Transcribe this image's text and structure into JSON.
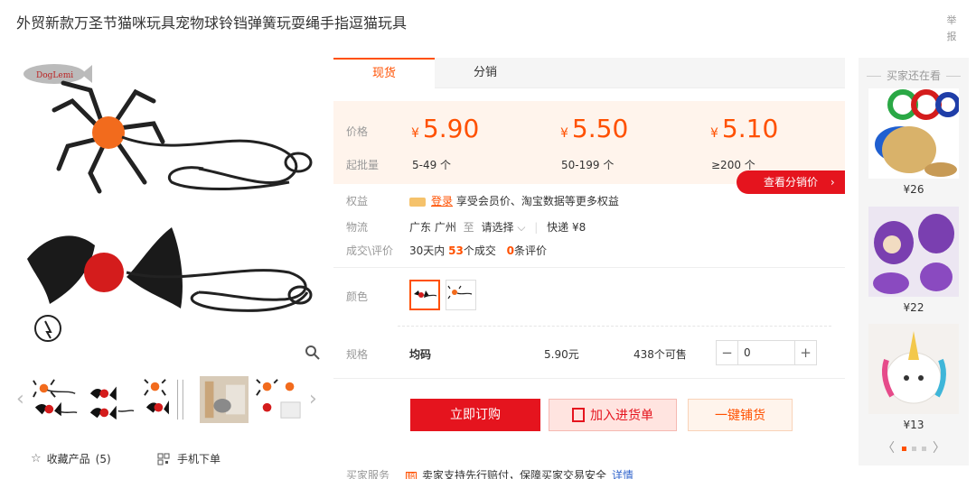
{
  "product": {
    "title": "外贸新款万圣节猫咪玩具宠物球铃铛弹簧玩耍绳手指逗猫玩具",
    "report_label": "举报",
    "brand_logo_text": "DogLemi"
  },
  "gallery": {
    "thumbs_count": 5,
    "favorite_label": "收藏产品",
    "favorite_count": "(5)",
    "mobile_order_label": "手机下单"
  },
  "tabs": [
    {
      "label": "现货",
      "active": true
    },
    {
      "label": "分销",
      "active": false
    }
  ],
  "pricing": {
    "price_label": "价格",
    "qty_label": "起批量",
    "currency": "¥",
    "tiers": [
      {
        "price": "5.90",
        "qty": "5-49 个"
      },
      {
        "price": "5.50",
        "qty": "50-199 个"
      },
      {
        "price": "5.10",
        "qty": "≥200 个"
      }
    ]
  },
  "rights": {
    "label": "权益",
    "login": "登录",
    "text": "享受会员价、淘宝数据等更多权益"
  },
  "distribution_button": "查看分销价",
  "logistics": {
    "label": "物流",
    "from": "广东 广州",
    "to_word": "至",
    "select": "请选择",
    "express": "快递 ¥8"
  },
  "deals": {
    "label": "成交\\评价",
    "prefix": "30天内",
    "count": "53",
    "count_suffix": "个成交",
    "reviews": "0",
    "reviews_suffix": "条评价"
  },
  "color": {
    "label": "颜色"
  },
  "spec": {
    "label": "规格",
    "name": "均码",
    "price": "5.90元",
    "stock": "438个可售",
    "quantity": "0",
    "minus": "−",
    "plus": "+"
  },
  "actions": {
    "order": "立即订购",
    "cart": "加入进货单",
    "dist": "一键铺货"
  },
  "service": {
    "label": "买家服务",
    "text": "卖家支持先行赔付，保障买家交易安全",
    "detail": "详情"
  },
  "sidebar": {
    "title": "买家还在看",
    "items": [
      {
        "price": "¥26"
      },
      {
        "price": "¥22"
      },
      {
        "price": "¥13"
      }
    ],
    "prev": "〈",
    "next": "〉"
  },
  "colors": {
    "accent": "#ff5000",
    "red": "#e5141e",
    "price_bg": "#fff4ec"
  }
}
